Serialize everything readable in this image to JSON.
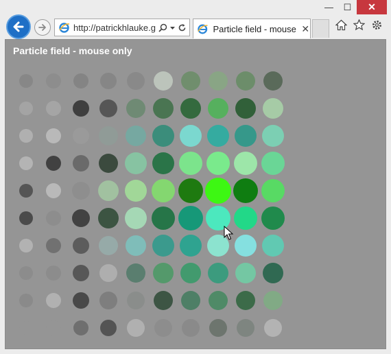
{
  "window": {
    "minimize_glyph": "—",
    "maximize_glyph": "☐",
    "close_glyph": "✕"
  },
  "nav": {
    "back_icon": "back-arrow-icon",
    "forward_icon": "forward-arrow-icon"
  },
  "address": {
    "url": "http://patrickhlauke.g"
  },
  "tab": {
    "title": "Particle field - mouse ...",
    "close_glyph": "✕"
  },
  "toolbar": {
    "home_icon": "home-icon",
    "favorites_icon": "star-icon",
    "settings_icon": "gear-icon"
  },
  "page": {
    "title": "Particle field - mouse only"
  },
  "particles": [
    [
      "#878787",
      "#8d8d8d",
      "#848484",
      "#868686",
      "#898989",
      "#bcc4bb",
      "#708e6d",
      "#89a585",
      "#6c8d6a",
      "#5a6a5a"
    ],
    [
      "#a4a4a4",
      "#a5a5a5",
      "#3f3f3f",
      "#565656",
      "#6f8a74",
      "#4a7552",
      "#346a3e",
      "#56b05e",
      "#316039",
      "#a6cba6"
    ],
    [
      "#b0b0b0",
      "#b9b9b9",
      "#9a9a9a",
      "#909b97",
      "#76a8a1",
      "#3b8d7b",
      "#7bd8cf",
      "#35aba0",
      "#36988a",
      "#7ccfb3"
    ],
    [
      "#b4b4b4",
      "#414141",
      "#6a6a6a",
      "#3b4a3e",
      "#87c3a2",
      "#2a7448",
      "#7ce48c",
      "#7aea8c",
      "#9de6a9",
      "#6ad696"
    ],
    [
      "#555555",
      "#b9b9b9",
      "#8e8e8e",
      "#a1c1a0",
      "#a1d798",
      "#84d770",
      "#1e7a10",
      "#3df713",
      "#0f7d11",
      "#58da64"
    ],
    [
      "#4b4b4b",
      "#8d8d8d",
      "#424242",
      "#3c5442",
      "#a5d8b5",
      "#267548",
      "#169878",
      "#4ce8be",
      "#22d888",
      "#208a4c"
    ],
    [
      "#b2b2b2",
      "#717171",
      "#5c5c5c",
      "#96aaa8",
      "#7fbdb9",
      "#3b9a8d",
      "#2fa390",
      "#8ce3cf",
      "#85e0e0",
      "#61c9b2"
    ],
    [
      "#8c8c8c",
      "#8c8c8c",
      "#575757",
      "#aeaeae",
      "#5a7e6f",
      "#54996b",
      "#429a6e",
      "#3c9b7e",
      "#74c7a3",
      "#306952"
    ],
    [
      "#8a8a8a",
      "#b1b1b1",
      "#494949",
      "#7e7e7e",
      "#8a8d8b",
      "#3d5544",
      "#4e7f66",
      "#4f8a67",
      "#3c6b49",
      "#81aa85"
    ],
    [
      "#959595",
      "#959595",
      "#6f6f6f",
      "#545454",
      "#b0b0b0",
      "#8d8d8d",
      "#8a8a8a",
      "#6d756e",
      "#7e8580",
      "#b3b3b3"
    ]
  ]
}
